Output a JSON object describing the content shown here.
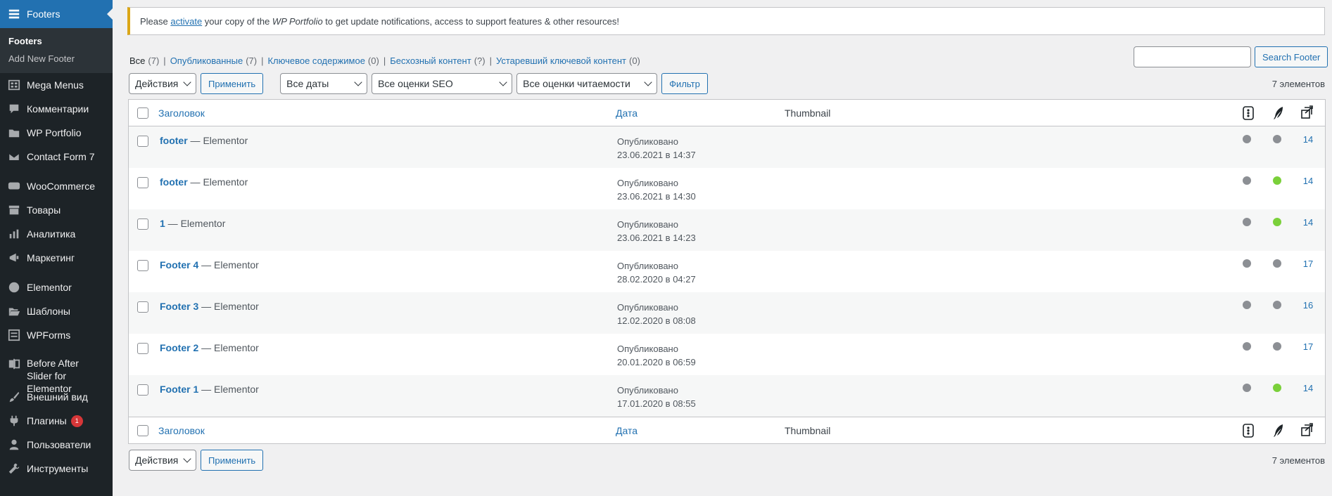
{
  "sidebar": {
    "active": "Footers",
    "submenu": [
      "Footers",
      "Add New Footer"
    ],
    "items": [
      {
        "label": "Mega Menus",
        "icon": "grid-icon"
      },
      {
        "label": "Комментарии",
        "icon": "comment-icon"
      },
      {
        "label": "WP Portfolio",
        "icon": "folder-icon"
      },
      {
        "label": "Contact Form 7",
        "icon": "mail-icon"
      },
      {
        "label": "WooCommerce",
        "icon": "woo-icon"
      },
      {
        "label": "Товары",
        "icon": "archive-icon"
      },
      {
        "label": "Аналитика",
        "icon": "bar-chart-icon"
      },
      {
        "label": "Маркетинг",
        "icon": "megaphone-icon"
      },
      {
        "label": "Elementor",
        "icon": "elementor-icon"
      },
      {
        "label": "Шаблоны",
        "icon": "folder-open-icon"
      },
      {
        "label": "WPForms",
        "icon": "form-icon"
      },
      {
        "label": "Before After Slider for Elementor",
        "icon": "slider-icon"
      },
      {
        "label": "Внешний вид",
        "icon": "brush-icon"
      },
      {
        "label": "Плагины",
        "icon": "plugin-icon",
        "badge": "1"
      },
      {
        "label": "Пользователи",
        "icon": "user-icon"
      },
      {
        "label": "Инструменты",
        "icon": "wrench-icon"
      }
    ]
  },
  "notice": {
    "before": "Please ",
    "link": "activate",
    "middle": " your copy of the ",
    "product": "WP Portfolio",
    "after": " to get update notifications, access to support features & other resources!"
  },
  "views": [
    {
      "label": "Все",
      "count": "(7)"
    },
    {
      "label": "Опубликованные",
      "count": "(7)"
    },
    {
      "label": "Ключевое содержимое",
      "count": "(0)"
    },
    {
      "label": "Бесхозный контент",
      "count": "(?)"
    },
    {
      "label": "Устаревший ключевой контент",
      "count": "(0)"
    }
  ],
  "search": {
    "button": "Search Footer",
    "value": ""
  },
  "filters": {
    "bulk": "Действия",
    "apply": "Применить",
    "dates": "Все даты",
    "seo": "Все оценки SEO",
    "readability": "Все оценки читаемости",
    "filter": "Фильтр"
  },
  "count_label": "7 элементов",
  "columns": {
    "title": "Заголовок",
    "date": "Дата",
    "thumbnail": "Thumbnail"
  },
  "rows": [
    {
      "title": "footer",
      "state": " — Elementor",
      "status": "Опубликовано",
      "date": "23.06.2021 в 14:37",
      "seo": "#8c8f94",
      "read": "#8c8f94",
      "links": "14"
    },
    {
      "title": "footer",
      "state": " — Elementor",
      "status": "Опубликовано",
      "date": "23.06.2021 в 14:30",
      "seo": "#8c8f94",
      "read": "#7ad03a",
      "links": "14"
    },
    {
      "title": "1",
      "state": " — Elementor",
      "status": "Опубликовано",
      "date": "23.06.2021 в 14:23",
      "seo": "#8c8f94",
      "read": "#7ad03a",
      "links": "14"
    },
    {
      "title": "Footer 4",
      "state": " — Elementor",
      "status": "Опубликовано",
      "date": "28.02.2020 в 04:27",
      "seo": "#8c8f94",
      "read": "#8c8f94",
      "links": "17"
    },
    {
      "title": "Footer 3",
      "state": " — Elementor",
      "status": "Опубликовано",
      "date": "12.02.2020 в 08:08",
      "seo": "#8c8f94",
      "read": "#8c8f94",
      "links": "16"
    },
    {
      "title": "Footer 2",
      "state": " — Elementor",
      "status": "Опубликовано",
      "date": "20.01.2020 в 06:59",
      "seo": "#8c8f94",
      "read": "#8c8f94",
      "links": "17"
    },
    {
      "title": "Footer 1",
      "state": " — Elementor",
      "status": "Опубликовано",
      "date": "17.01.2020 в 08:55",
      "seo": "#8c8f94",
      "read": "#7ad03a",
      "links": "14"
    }
  ]
}
